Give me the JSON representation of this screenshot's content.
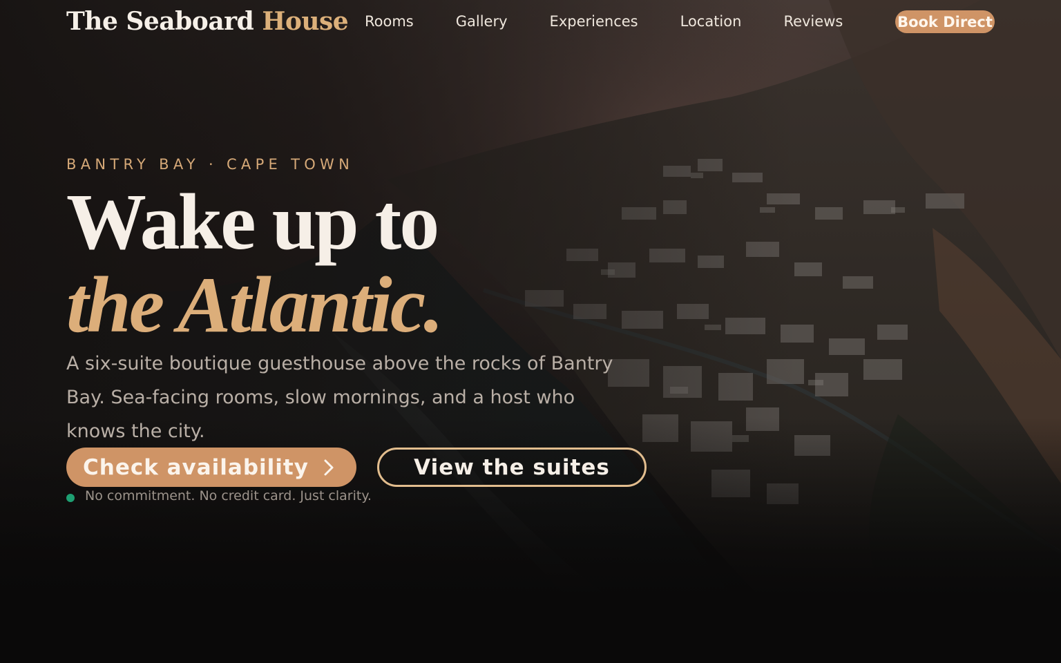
{
  "brand": {
    "name": "The Seaboard",
    "accent": "House"
  },
  "nav": {
    "links": [
      "Rooms",
      "Gallery",
      "Experiences",
      "Location",
      "Reviews"
    ],
    "cta": "Book Direct"
  },
  "hero": {
    "eyebrow": "BANTRY BAY · CAPE TOWN",
    "headline_line1": "Wake up to",
    "headline_line2": "the Atlantic.",
    "lede": "A six-suite boutique guesthouse above the rocks of Bantry Bay. Sea-facing rooms, slow mornings, and a host who knows the city.",
    "primary_cta": "Check availability",
    "secondary_cta": "View the suites",
    "reassurance": "No commitment. No credit card. Just clarity."
  },
  "icons": {
    "primary_cta": "chevron-right-icon",
    "status": "status-dot-icon"
  },
  "colors": {
    "accent": "#cf9466",
    "accent_text": "#dcae7a",
    "background": "#0a0909",
    "status": "#1e9f72"
  }
}
